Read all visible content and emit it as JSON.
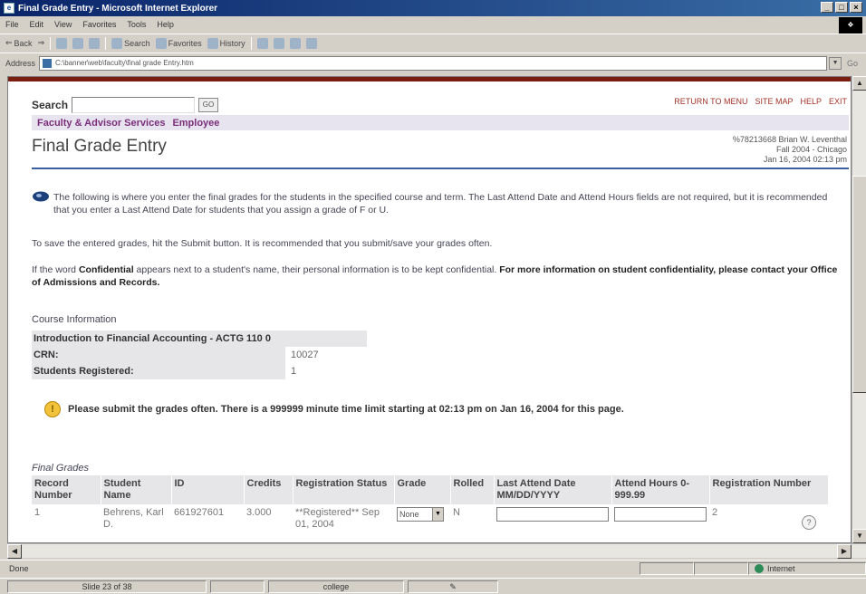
{
  "window": {
    "title": "Final Grade Entry - Microsoft Internet Explorer",
    "controls": [
      "_",
      "□",
      "×"
    ]
  },
  "menu": [
    "File",
    "Edit",
    "View",
    "Favorites",
    "Tools",
    "Help"
  ],
  "toolbar": {
    "back": "Back",
    "search": "Search",
    "favorites": "Favorites",
    "history": "History"
  },
  "address": {
    "label": "Address",
    "url": "C:\\banner\\web\\faculty\\final grade Entry.htm",
    "go": "Go"
  },
  "page": {
    "search_label": "Search",
    "search_value": "",
    "go_label": "GO",
    "links": [
      "RETURN TO MENU",
      "SITE MAP",
      "HELP",
      "EXIT"
    ],
    "sections": [
      "Faculty & Advisor Services",
      "Employee"
    ],
    "title": "Final Grade Entry",
    "user_lines": [
      "%78213668 Brian W. Leventhal",
      "Fall 2004 - Chicago",
      "Jan 16, 2004 02:13 pm"
    ],
    "info1": "The following is where you enter the final grades for the students in the specified course and term. The Last Attend Date and Attend Hours fields are not required, but it is recommended that you enter a Last Attend Date for students that you assign a grade of F or U.",
    "info2": "To save the entered grades, hit the Submit button. It is recommended that you submit/save your grades often.",
    "info3_pre": "If the word ",
    "info3_bold1": "Confidential",
    "info3_mid": " appears next to a student's name, their personal information is to be kept confidential. ",
    "info3_bold2": "For more information on student confidentiality, please contact your Office of Admissions and Records.",
    "course_heading": "Course Information",
    "course_name": "Introduction to Financial Accounting - ACTG 110 0",
    "crn_label": "CRN:",
    "crn_value": "10027",
    "reg_label": "Students Registered:",
    "reg_value": "1",
    "warning": "Please submit the grades often. There is a 999999 minute time limit starting at 02:13 pm on Jan 16, 2004 for this page.",
    "final_grades_heading": "Final Grades",
    "grade_columns": [
      "Record Number",
      "Student Name",
      "ID",
      "Credits",
      "Registration Status",
      "Grade",
      "Rolled",
      "Last Attend Date MM/DD/YYYY",
      "Attend Hours 0-999.99",
      "Registration Number"
    ],
    "rows": [
      {
        "record": "1",
        "name": "Behrens, Karl D.",
        "id": "661927601",
        "credits": "3.000",
        "status": "**Registered** Sep 01, 2004",
        "grade": "None",
        "rolled": "N",
        "reg_number": "2"
      }
    ]
  },
  "status": {
    "left": "Done",
    "zone": "Internet"
  },
  "slide": {
    "counter": "Slide 23 of 38",
    "template": "college"
  }
}
